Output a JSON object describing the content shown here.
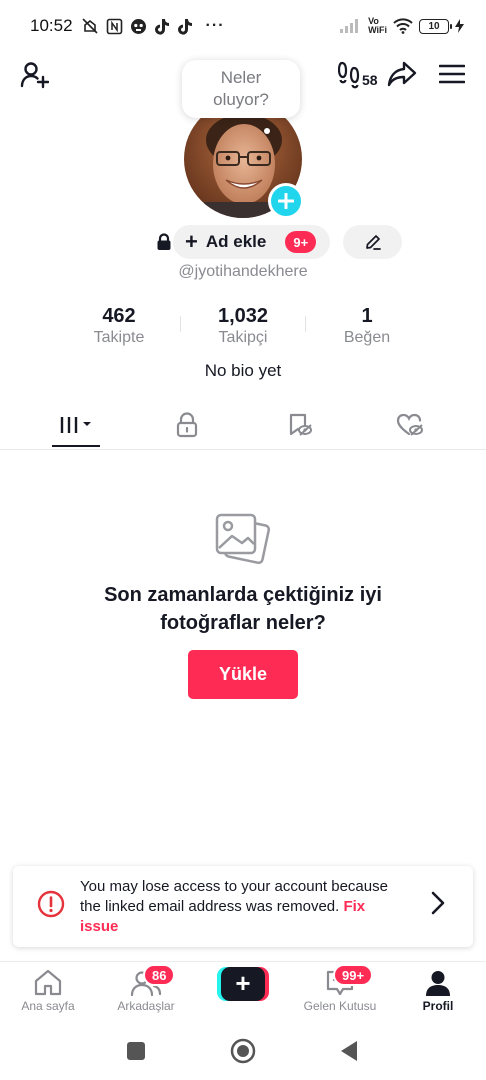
{
  "status_bar": {
    "time": "10:52",
    "network_label": "Vo WiFi",
    "network_label_line1": "Vo",
    "network_label_line2": "WiFi",
    "battery": "10",
    "more_dots": "···"
  },
  "header": {
    "visitors_count": "58"
  },
  "bubble": {
    "text": "Neler oluyor?"
  },
  "profile": {
    "add_name_label": "Ad ekle",
    "add_name_plus": "+",
    "add_name_badge": "9+",
    "username": "@jyotihandekhere",
    "bio": "No bio yet"
  },
  "stats": [
    {
      "value": "462",
      "label": "Takipte"
    },
    {
      "value": "1,032",
      "label": "Takipçi"
    },
    {
      "value": "1",
      "label": "Beğen"
    }
  ],
  "empty_state": {
    "title": "Son zamanlarda çektiğiniz iyi fotoğraflar neler?",
    "upload_label": "Yükle"
  },
  "warning": {
    "message": "You may lose access to your account because the linked email address was removed.",
    "link_label": "Fix issue"
  },
  "bottom_nav": {
    "home_label": "Ana sayfa",
    "friends_label": "Arkadaşlar",
    "friends_badge": "86",
    "create_label": "+",
    "inbox_label": "Gelen Kutusu",
    "inbox_badge": "99+",
    "profile_label": "Profil"
  },
  "colors": {
    "accent": "#fe2c55",
    "cyan": "#20d5ec",
    "text": "#161823",
    "muted": "#8a8b91"
  }
}
